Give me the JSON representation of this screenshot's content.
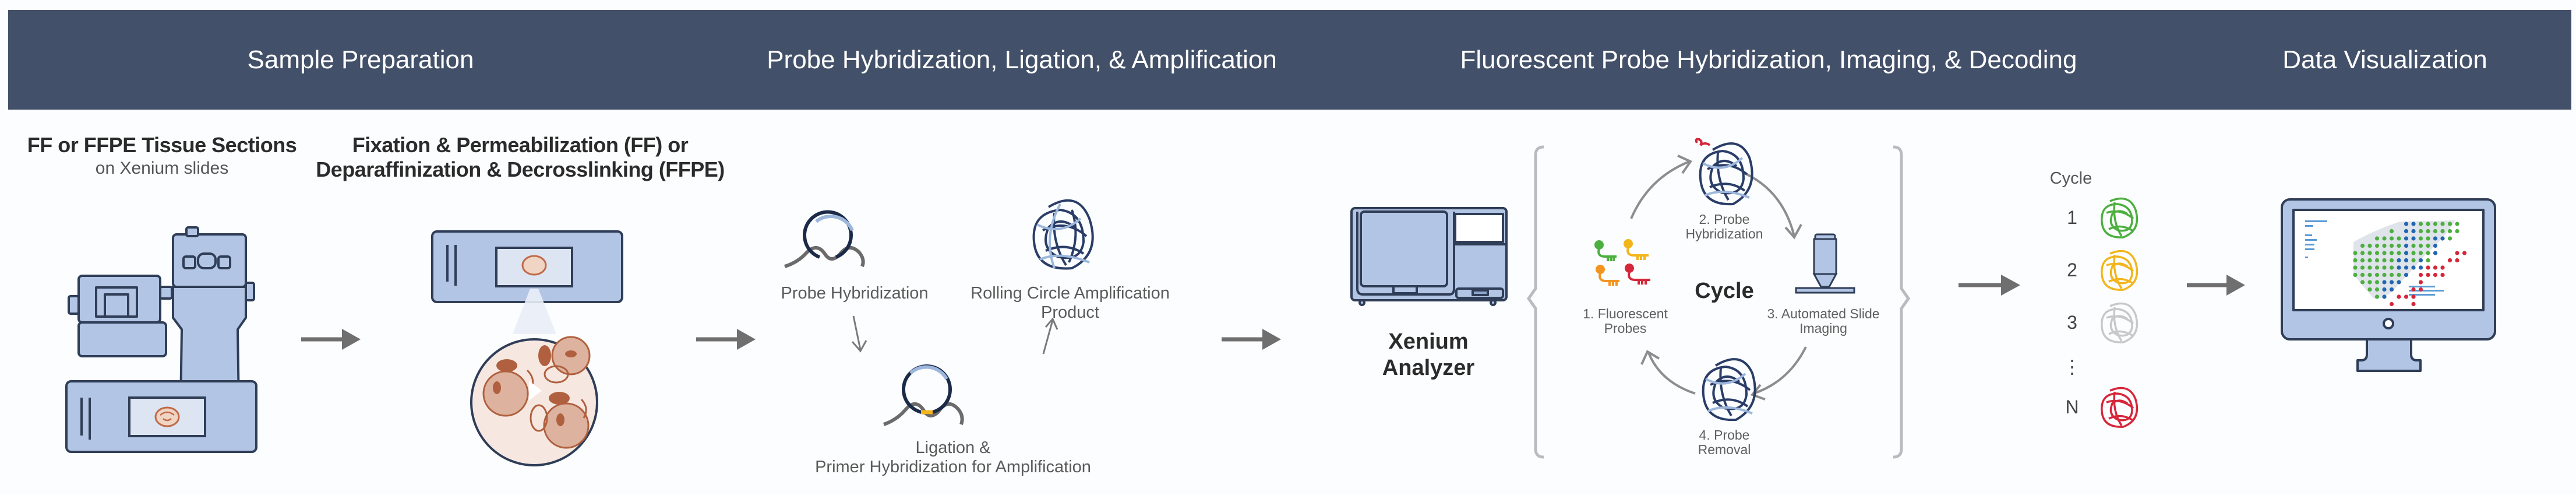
{
  "header": {
    "sections": [
      {
        "label": "Sample Preparation"
      },
      {
        "label": "Probe Hybridization, Ligation, & Amplification"
      },
      {
        "label": "Fluorescent Probe Hybridization, Imaging, & Decoding"
      },
      {
        "label": "Data Visualization"
      }
    ]
  },
  "sample_prep": {
    "step1_title": "FF or FFPE Tissue Sections",
    "step1_sub": "on Xenium slides",
    "step2_title_line1": "Fixation & Permeabilization (FF) or",
    "step2_title_line2": "Deparaffinization & Decrosslinking (FFPE)"
  },
  "probe_section": {
    "probe_hybridization": "Probe Hybridization",
    "rca_line1": "Rolling Circle Amplification",
    "rca_line2": "Product",
    "ligation_line1": "Ligation &",
    "ligation_line2": "Primer Hybridization for Amplification"
  },
  "imaging_section": {
    "analyzer_line1": "Xenium",
    "analyzer_line2": "Analyzer",
    "cycle_center": "Cycle",
    "steps": [
      {
        "line1": "1. Fluorescent",
        "line2": "Probes"
      },
      {
        "line1": "2. Probe",
        "line2": "Hybridization"
      },
      {
        "line1": "3. Automated Slide",
        "line2": "Imaging"
      },
      {
        "line1": "4. Probe",
        "line2": "Removal"
      }
    ]
  },
  "decoding": {
    "title": "Cycle",
    "cycles": [
      {
        "label": "1",
        "color": "#4caf3f"
      },
      {
        "label": "2",
        "color": "#f2b51c"
      },
      {
        "label": "3",
        "color": "#c8c8c8"
      },
      {
        "label": "⋮",
        "color": null
      },
      {
        "label": "N",
        "color": "#d6263a"
      }
    ]
  },
  "colors": {
    "header_bg": "#435069",
    "device_fill": "#b3c5e4",
    "device_stroke": "#2f3d57",
    "tissue": "#c06a48",
    "arrow": "#6f6f6f",
    "probe_green": "#4caf3f",
    "probe_yellow": "#f2b51c",
    "probe_orange": "#f29420",
    "probe_red": "#d6263a",
    "spot_blue": "#2166b0"
  }
}
